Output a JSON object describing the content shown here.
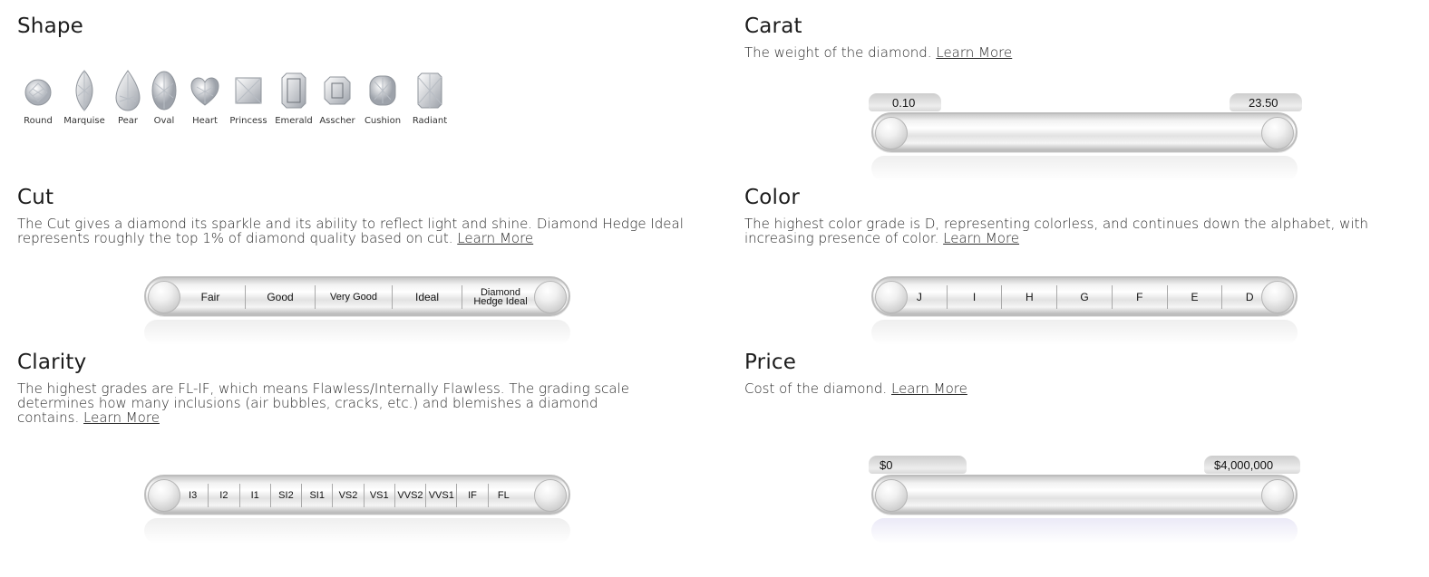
{
  "shape": {
    "title": "Shape",
    "items": [
      {
        "label": "Round",
        "icon": "round-diamond-icon"
      },
      {
        "label": "Marquise",
        "icon": "marquise-diamond-icon"
      },
      {
        "label": "Pear",
        "icon": "pear-diamond-icon"
      },
      {
        "label": "Oval",
        "icon": "oval-diamond-icon"
      },
      {
        "label": "Heart",
        "icon": "heart-diamond-icon"
      },
      {
        "label": "Princess",
        "icon": "princess-diamond-icon"
      },
      {
        "label": "Emerald",
        "icon": "emerald-diamond-icon"
      },
      {
        "label": "Asscher",
        "icon": "asscher-diamond-icon"
      },
      {
        "label": "Cushion",
        "icon": "cushion-diamond-icon"
      },
      {
        "label": "Radiant",
        "icon": "radiant-diamond-icon"
      }
    ]
  },
  "carat": {
    "title": "Carat",
    "description": "The weight of the diamond.",
    "link": "Learn More",
    "min": "0.10",
    "max": "23.50"
  },
  "cut": {
    "title": "Cut",
    "description": "The Cut gives a diamond its sparkle and its ability to reflect light and shine. Diamond Hedge Ideal represents roughly the top 1% of diamond quality based on cut.",
    "link": "Learn More",
    "grades": [
      "Fair",
      "Good",
      "Very Good",
      "Ideal",
      "Diamond Hedge Ideal"
    ]
  },
  "color": {
    "title": "Color",
    "description": "The highest color grade is D, representing colorless, and continues down the alphabet, with increasing presence of color.",
    "link": "Learn More",
    "grades": [
      "J",
      "I",
      "H",
      "G",
      "F",
      "E",
      "D"
    ]
  },
  "clarity": {
    "title": "Clarity",
    "description": "The highest grades are FL-IF, which means Flawless/Internally Flawless. The grading scale determines how many inclusions (air bubbles, cracks, etc.) and blemishes a diamond contains.",
    "link": "Learn More",
    "grades": [
      "I3",
      "I2",
      "I1",
      "SI2",
      "SI1",
      "VS2",
      "VS1",
      "VVS2",
      "VVS1",
      "IF",
      "FL"
    ]
  },
  "price": {
    "title": "Price",
    "description": "Cost of the diamond.",
    "link": "Learn More",
    "min": "$0",
    "max": "$4,000,000"
  }
}
